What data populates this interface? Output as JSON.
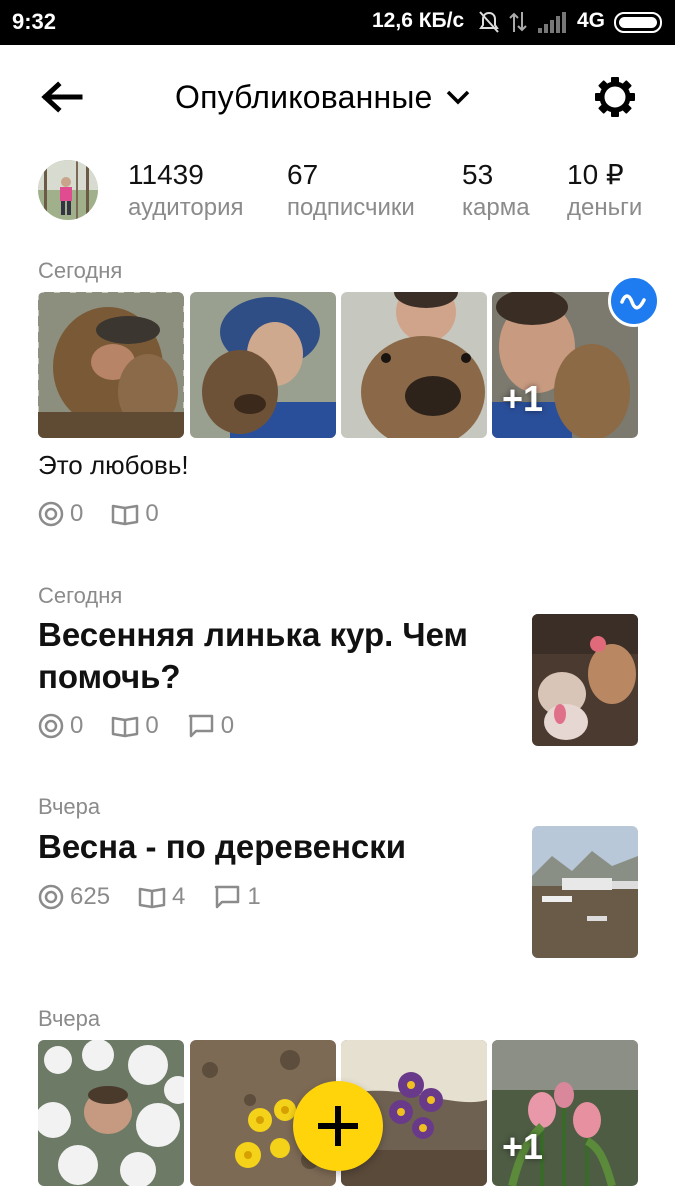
{
  "status_bar": {
    "time": "9:32",
    "speed": "12,6 КБ/с",
    "network": "4G"
  },
  "header": {
    "title": "Опубликованные",
    "back_icon": "arrow-left-icon",
    "dropdown_icon": "chevron-down-icon",
    "settings_icon": "gear-icon"
  },
  "stats": [
    {
      "value": "11439",
      "label": "аудитория"
    },
    {
      "value": "67",
      "label": "подписчики"
    },
    {
      "value": "53",
      "label": "карма"
    },
    {
      "value": "10 ₽",
      "label": "деньги"
    }
  ],
  "posts": [
    {
      "date": "Сегодня",
      "type": "gallery",
      "more_label": "+1",
      "caption": "Это любовь!",
      "views": "0",
      "reads": "0"
    },
    {
      "date": "Сегодня",
      "type": "article",
      "title": "Весенняя линька кур. Чем помочь?",
      "views": "0",
      "reads": "0",
      "comments": "0"
    },
    {
      "date": "Вчера",
      "type": "article",
      "title": "Весна - по деревенски",
      "views": "625",
      "reads": "4",
      "comments": "1"
    },
    {
      "date": "Вчера",
      "type": "gallery",
      "more_label": "+1"
    }
  ],
  "colors": {
    "accent_blue": "#1e7bf0",
    "fab_yellow": "#ffd40a",
    "muted_text": "#8b8b8b"
  },
  "fab_icon": "plus-icon",
  "badge_icon": "wave-icon"
}
